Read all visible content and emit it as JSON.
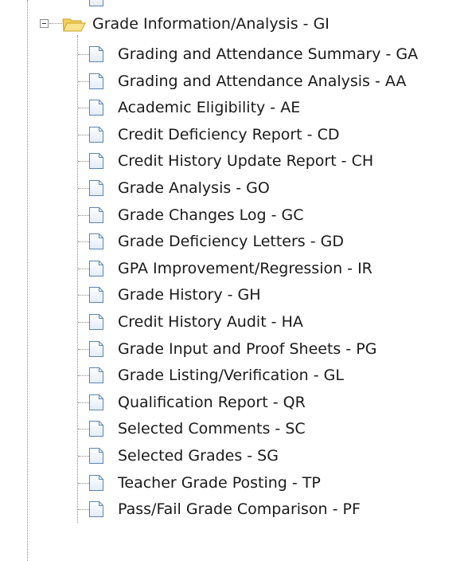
{
  "tree": {
    "folder": {
      "label": "Grade Information/Analysis - GI",
      "expanded": true,
      "icon": "folder-open-icon"
    },
    "items": [
      {
        "label": "Grading and Attendance Summary - GA",
        "icon": "document-icon"
      },
      {
        "label": "Grading and Attendance Analysis - AA",
        "icon": "document-icon"
      },
      {
        "label": "Academic Eligibility - AE",
        "icon": "document-icon"
      },
      {
        "label": "Credit Deficiency Report - CD",
        "icon": "document-icon"
      },
      {
        "label": "Credit History Update Report - CH",
        "icon": "document-icon"
      },
      {
        "label": "Grade Analysis - GO",
        "icon": "document-icon"
      },
      {
        "label": "Grade Changes Log - GC",
        "icon": "document-icon"
      },
      {
        "label": "Grade Deficiency Letters - GD",
        "icon": "document-icon"
      },
      {
        "label": "GPA Improvement/Regression - IR",
        "icon": "document-icon"
      },
      {
        "label": "Grade History - GH",
        "icon": "document-icon"
      },
      {
        "label": "Credit History Audit - HA",
        "icon": "document-icon"
      },
      {
        "label": "Grade Input and Proof Sheets - PG",
        "icon": "document-icon"
      },
      {
        "label": "Grade Listing/Verification - GL",
        "icon": "document-icon"
      },
      {
        "label": "Qualification Report - QR",
        "icon": "document-icon"
      },
      {
        "label": "Selected Comments - SC",
        "icon": "document-icon"
      },
      {
        "label": "Selected Grades - SG",
        "icon": "document-icon"
      },
      {
        "label": "Teacher Grade Posting - TP",
        "icon": "document-icon"
      },
      {
        "label": "Pass/Fail Grade Comparison - PF",
        "icon": "document-icon"
      }
    ]
  },
  "colors": {
    "folder_fill": "#f7d56b",
    "folder_stroke": "#c9a227",
    "doc_stroke": "#5a86b5",
    "connector": "#8c8c8c"
  }
}
